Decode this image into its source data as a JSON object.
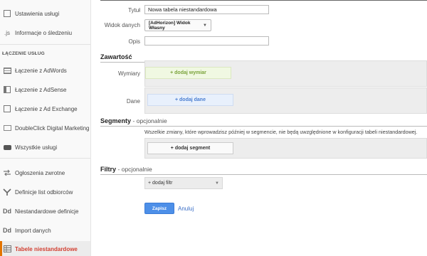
{
  "sidebar": {
    "items_top": [
      {
        "label": "Ustawienia usługi",
        "icon": "page-icon"
      },
      {
        "label": "Informacje o śledzeniu",
        "icon": "js-icon"
      }
    ],
    "section_header": "ŁĄCZENIE USŁUG",
    "items_linking": [
      {
        "label": "Łączenie z AdWords",
        "icon": "adwords-icon"
      },
      {
        "label": "Łączenie z AdSense",
        "icon": "adsense-icon"
      },
      {
        "label": "Łączenie z Ad Exchange",
        "icon": "ad-exchange-icon"
      },
      {
        "label": "DoubleClick Digital Marketing",
        "icon": "doubleclick-icon"
      },
      {
        "label": "Wszystkie usługi",
        "icon": "link-icon"
      }
    ],
    "items_bottom": [
      {
        "label": "Ogłoszenia zwrotne",
        "icon": "postback-icon"
      },
      {
        "label": "Definicje list odbiorców",
        "icon": "audience-icon"
      },
      {
        "label": "Niestandardowe definicje",
        "icon": "dd-icon"
      },
      {
        "label": "Import danych",
        "icon": "dd-icon"
      },
      {
        "label": "Tabele niestandardowe",
        "icon": "table-icon",
        "active": true
      }
    ]
  },
  "form": {
    "title_label": "Tytuł",
    "title_value": "Nowa tabela niestandardowa",
    "view_label": "Widok danych",
    "view_value": "[AdHorizon] Widok Własny",
    "desc_label": "Opis",
    "desc_value": ""
  },
  "content": {
    "title": "Zawartość",
    "dimensions_label": "Wymiary",
    "add_dimension": "+ dodaj wymiar",
    "data_label": "Dane",
    "add_data": "+ dodaj dane"
  },
  "segments": {
    "title": "Segmenty",
    "optional": "- opcjonalnie",
    "note": "Wszelkie zmiany, które wprowadzisz później w segmencie, nie będą uwzględnione w konfiguracji tabeli niestandardowej.",
    "add_segment": "+ dodaj segment"
  },
  "filters": {
    "title": "Filtry",
    "optional": "- opcjonalnie",
    "add_filter": "+ dodaj filtr"
  },
  "actions": {
    "save": "Zapisz",
    "cancel": "Anuluj"
  },
  "colors": {
    "accent": "#e37400",
    "active_text": "#d23f31",
    "primary_button": "#4d8fe8"
  }
}
